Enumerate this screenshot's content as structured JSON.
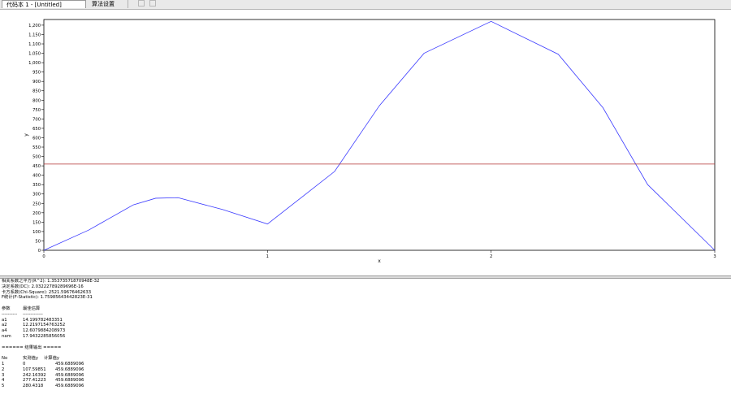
{
  "tabs": [
    {
      "label": "代码本 1 - [Untitled]",
      "active": true
    },
    {
      "label": "算法设置",
      "active": false
    },
    {
      "label": "",
      "active": false,
      "icons": true
    }
  ],
  "chart_data": {
    "type": "line",
    "xlabel": "x",
    "ylabel": "y",
    "xlim": [
      0,
      3
    ],
    "ylim": [
      0,
      1230
    ],
    "x_ticks": [
      "0",
      "1",
      "2",
      "3"
    ],
    "y_ticks": [
      "0",
      "50",
      "100",
      "150",
      "200",
      "250",
      "300",
      "350",
      "400",
      "450",
      "500",
      "550",
      "600",
      "650",
      "700",
      "750",
      "800",
      "850",
      "900",
      "950",
      "1,000",
      "1,050",
      "1,100",
      "1,150",
      "1,200"
    ],
    "series": [
      {
        "color": "#3a3aff",
        "x": [
          0,
          0.2,
          0.4,
          0.5,
          0.6,
          0.8,
          1.0,
          1.3,
          1.5,
          1.7,
          2.0,
          2.3,
          2.5,
          2.7,
          3.0
        ],
        "y": [
          0,
          107.5,
          242.2,
          277.4,
          280.4,
          217,
          140,
          420,
          770,
          1050,
          1220,
          1045,
          760,
          350,
          0
        ]
      },
      {
        "color": "#b03030",
        "x": [
          0,
          3
        ],
        "y": [
          459.69,
          459.69
        ]
      }
    ]
  },
  "output": {
    "stats": [
      "相关系数之平方(R^2): 1.35373571870948E-32",
      "决定系数(DC): 2.03222789289696E-16",
      "卡方系数(Chi-Square): 2521.59676462633",
      "F统计(F-Statistic): 1.75985643442823E-31"
    ],
    "param_header": [
      "参数",
      "最佳估算"
    ],
    "param_sep": [
      "----------",
      "-------------"
    ],
    "params": [
      {
        "name": "a1",
        "value": "14.199782483351"
      },
      {
        "name": "a2",
        "value": "12.2197154763252"
      },
      {
        "name": "a4",
        "value": "12.6079884208973"
      },
      {
        "name": "nam",
        "value": "17.9432285856056"
      }
    ],
    "result_title": "====== 结果输出 =====",
    "result_header": [
      "No",
      "实测值y",
      "计算值y"
    ],
    "rows": [
      [
        "1",
        "0",
        "459.6889096"
      ],
      [
        "2",
        "107.59851",
        "459.6889096"
      ],
      [
        "3",
        "242.16392",
        "459.6889096"
      ],
      [
        "4",
        "277.41223",
        "459.6889096"
      ],
      [
        "5",
        "280.4318",
        "459.6889096"
      ]
    ]
  }
}
